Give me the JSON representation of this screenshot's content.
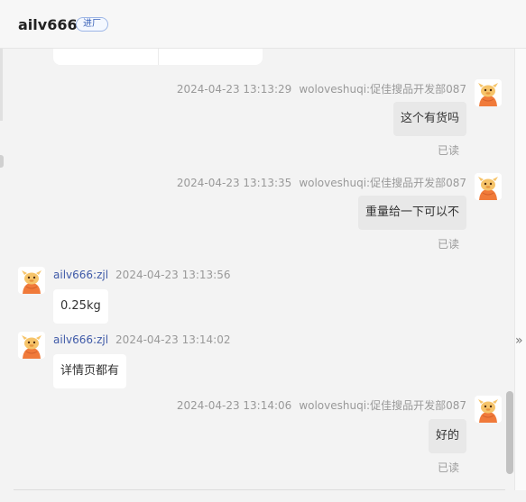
{
  "header": {
    "title": "ailv666",
    "badge": "进厂"
  },
  "messages": [
    {
      "direction": "out",
      "time": "2024-04-23 13:13:29",
      "sender": "woloveshuqi:促佳搜品开发部087",
      "text": "这个有货吗",
      "status": "已读",
      "avatar_icon": "cat-mascot-icon"
    },
    {
      "direction": "out",
      "time": "2024-04-23 13:13:35",
      "sender": "woloveshuqi:促佳搜品开发部087",
      "text": "重量给一下可以不",
      "status": "已读",
      "avatar_icon": "cat-mascot-icon"
    },
    {
      "direction": "in",
      "sender": "ailv666:zjl",
      "time": "2024-04-23 13:13:56",
      "text": "0.25kg",
      "avatar_icon": "cat-mascot-icon"
    },
    {
      "direction": "in",
      "sender": "ailv666:zjl",
      "time": "2024-04-23 13:14:02",
      "text": "详情页都有",
      "avatar_icon": "cat-mascot-icon"
    },
    {
      "direction": "out",
      "time": "2024-04-23 13:14:06",
      "sender": "woloveshuqi:促佳搜品开发部087",
      "text": "好的",
      "status": "已读",
      "avatar_icon": "cat-mascot-icon"
    }
  ],
  "side_panel": {
    "toggle_icon": "double-chevron-right-icon",
    "toggle_glyph": "»"
  },
  "colors": {
    "avatar_orange": "#f07a3a",
    "avatar_face": "#f6c46a",
    "badge_blue": "#3b63b8",
    "sender_in": "#3f5aa8"
  }
}
